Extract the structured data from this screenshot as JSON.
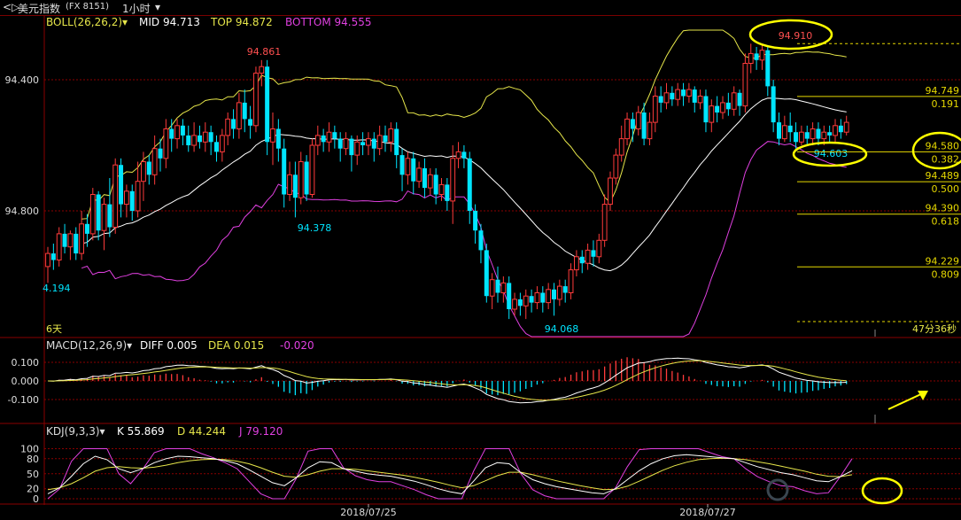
{
  "title": {
    "nav_icon": "back-forward-icon",
    "instrument": "美元指数",
    "code": "(FX 8151)",
    "period": "1小时"
  },
  "boll": {
    "label": "BOLL(26,26,2)",
    "mid": "MID 94.713",
    "top": "TOP 94.872",
    "bottom": "BOTTOM 94.555"
  },
  "macd": {
    "label": "MACD(12,26,9)",
    "diff": "DIFF 0.005",
    "dea": "DEA 0.015",
    "macd": "-0.020"
  },
  "kdj": {
    "label": "KDJ(9,3,3)",
    "k": "K 55.869",
    "d": "D 44.244",
    "j": "J 79.120"
  },
  "colors": {
    "up": "#ff3b3b",
    "down": "#00e5ff",
    "mid": "#ffffff",
    "upper": "#e6e64a",
    "lower": "#e040e0",
    "grid": "#8a0000",
    "fib": "#e6d800",
    "highlight": "#ffff00"
  },
  "chart_data": [
    {
      "type": "candlestick",
      "ylim": [
        94.0,
        95.0
      ],
      "yticks": [
        94.4,
        94.8
      ],
      "ytick_labels": [
        "94.800",
        "94.400"
      ],
      "xtick_labels": [
        "2018/07/25",
        "2018/07/27"
      ],
      "annotations": {
        "high_left": "94.861",
        "low_left": "94.378",
        "low_bottom": "94.068",
        "low_edge": "4.194",
        "high_right": "94.910",
        "low_right": "94.603",
        "days_label": "6天",
        "countdown": "47分36秒"
      },
      "fib_levels": [
        {
          "price": "94.749",
          "ratio": "0.191",
          "value": 94.749
        },
        {
          "price": "94.580",
          "ratio": "0.382",
          "value": 94.58
        },
        {
          "price": "94.489",
          "ratio": "0.500",
          "value": 94.489
        },
        {
          "price": "94.390",
          "ratio": "0.618",
          "value": 94.39
        },
        {
          "price": "94.229",
          "ratio": "0.809",
          "value": 94.229
        }
      ],
      "fib_top": 94.91,
      "candles": [
        [
          94.23,
          94.27,
          94.18,
          94.29
        ],
        [
          94.27,
          94.25,
          94.22,
          94.3
        ],
        [
          94.25,
          94.33,
          94.23,
          94.35
        ],
        [
          94.33,
          94.29,
          94.27,
          94.36
        ],
        [
          94.29,
          94.33,
          94.25,
          94.34
        ],
        [
          94.33,
          94.27,
          94.25,
          94.35
        ],
        [
          94.27,
          94.36,
          94.25,
          94.4
        ],
        [
          94.36,
          94.33,
          94.29,
          94.39
        ],
        [
          94.33,
          94.45,
          94.31,
          94.47
        ],
        [
          94.45,
          94.34,
          94.31,
          94.46
        ],
        [
          94.34,
          94.42,
          94.28,
          94.44
        ],
        [
          94.42,
          94.35,
          94.32,
          94.5
        ],
        [
          94.35,
          94.54,
          94.33,
          94.56
        ],
        [
          94.54,
          94.42,
          94.38,
          94.56
        ],
        [
          94.42,
          94.46,
          94.38,
          94.48
        ],
        [
          94.46,
          94.4,
          94.37,
          94.48
        ],
        [
          94.4,
          94.49,
          94.38,
          94.55
        ],
        [
          94.49,
          94.55,
          94.43,
          94.58
        ],
        [
          94.55,
          94.51,
          94.48,
          94.57
        ],
        [
          94.51,
          94.59,
          94.48,
          94.63
        ],
        [
          94.59,
          94.56,
          94.52,
          94.62
        ],
        [
          94.56,
          94.65,
          94.53,
          94.68
        ],
        [
          94.65,
          94.62,
          94.58,
          94.68
        ],
        [
          94.62,
          94.66,
          94.59,
          94.68
        ],
        [
          94.66,
          94.63,
          94.6,
          94.68
        ],
        [
          94.63,
          94.6,
          94.58,
          94.66
        ],
        [
          94.6,
          94.63,
          94.58,
          94.67
        ],
        [
          94.63,
          94.61,
          94.59,
          94.66
        ],
        [
          94.61,
          94.64,
          94.58,
          94.67
        ],
        [
          94.64,
          94.61,
          94.57,
          94.66
        ],
        [
          94.61,
          94.58,
          94.55,
          94.63
        ],
        [
          94.58,
          94.63,
          94.55,
          94.65
        ],
        [
          94.63,
          94.68,
          94.6,
          94.7
        ],
        [
          94.68,
          94.65,
          94.62,
          94.71
        ],
        [
          94.65,
          94.73,
          94.62,
          94.76
        ],
        [
          94.73,
          94.68,
          94.64,
          94.77
        ],
        [
          94.68,
          94.66,
          94.62,
          94.72
        ],
        [
          94.66,
          94.82,
          94.64,
          94.84
        ],
        [
          94.82,
          94.84,
          94.78,
          94.86
        ],
        [
          94.84,
          94.61,
          94.57,
          94.86
        ],
        [
          94.61,
          94.65,
          94.54,
          94.7
        ],
        [
          94.65,
          94.59,
          94.55,
          94.68
        ],
        [
          94.59,
          94.45,
          94.41,
          94.62
        ],
        [
          94.45,
          94.51,
          94.43,
          94.55
        ],
        [
          94.51,
          94.44,
          94.38,
          94.55
        ],
        [
          94.44,
          94.55,
          94.42,
          94.58
        ],
        [
          94.55,
          94.45,
          94.43,
          94.57
        ],
        [
          94.45,
          94.6,
          94.44,
          94.62
        ],
        [
          94.6,
          94.63,
          94.57,
          94.66
        ],
        [
          94.63,
          94.61,
          94.58,
          94.65
        ],
        [
          94.61,
          94.64,
          94.58,
          94.67
        ],
        [
          94.64,
          94.62,
          94.59,
          94.66
        ],
        [
          94.62,
          94.59,
          94.55,
          94.64
        ],
        [
          94.59,
          94.62,
          94.57,
          94.64
        ],
        [
          94.62,
          94.57,
          94.52,
          94.63
        ],
        [
          94.57,
          94.61,
          94.54,
          94.63
        ],
        [
          94.61,
          94.6,
          94.57,
          94.64
        ],
        [
          94.6,
          94.62,
          94.57,
          94.64
        ],
        [
          94.62,
          94.59,
          94.55,
          94.64
        ],
        [
          94.59,
          94.63,
          94.57,
          94.66
        ],
        [
          94.63,
          94.61,
          94.58,
          94.66
        ],
        [
          94.61,
          94.65,
          94.58,
          94.67
        ],
        [
          94.65,
          94.57,
          94.53,
          94.67
        ],
        [
          94.57,
          94.51,
          94.46,
          94.59
        ],
        [
          94.51,
          94.56,
          94.48,
          94.58
        ],
        [
          94.56,
          94.49,
          94.45,
          94.58
        ],
        [
          94.49,
          94.53,
          94.47,
          94.55
        ],
        [
          94.53,
          94.47,
          94.44,
          94.56
        ],
        [
          94.47,
          94.51,
          94.45,
          94.53
        ],
        [
          94.51,
          94.45,
          94.42,
          94.53
        ],
        [
          94.45,
          94.48,
          94.43,
          94.5
        ],
        [
          94.48,
          94.43,
          94.4,
          94.5
        ],
        [
          94.43,
          94.56,
          94.36,
          94.6
        ],
        [
          94.56,
          94.58,
          94.53,
          94.61
        ],
        [
          94.58,
          94.56,
          94.53,
          94.6
        ],
        [
          94.56,
          94.4,
          94.36,
          94.58
        ],
        [
          94.4,
          94.34,
          94.3,
          94.42
        ],
        [
          94.34,
          94.28,
          94.24,
          94.36
        ],
        [
          94.28,
          94.14,
          94.12,
          94.3
        ],
        [
          94.14,
          94.19,
          94.1,
          94.21
        ],
        [
          94.19,
          94.15,
          94.12,
          94.23
        ],
        [
          94.15,
          94.18,
          94.12,
          94.2
        ],
        [
          94.18,
          94.1,
          94.07,
          94.2
        ],
        [
          94.1,
          94.13,
          94.08,
          94.15
        ],
        [
          94.13,
          94.11,
          94.08,
          94.15
        ],
        [
          94.11,
          94.14,
          94.07,
          94.16
        ],
        [
          94.14,
          94.12,
          94.09,
          94.16
        ],
        [
          94.12,
          94.15,
          94.1,
          94.17
        ],
        [
          94.15,
          94.12,
          94.09,
          94.17
        ],
        [
          94.12,
          94.16,
          94.1,
          94.18
        ],
        [
          94.16,
          94.13,
          94.08,
          94.18
        ],
        [
          94.13,
          94.17,
          94.11,
          94.19
        ],
        [
          94.17,
          94.15,
          94.12,
          94.19
        ],
        [
          94.15,
          94.22,
          94.13,
          94.24
        ],
        [
          94.22,
          94.26,
          94.2,
          94.28
        ],
        [
          94.26,
          94.24,
          94.21,
          94.28
        ],
        [
          94.24,
          94.28,
          94.22,
          94.3
        ],
        [
          94.28,
          94.26,
          94.23,
          94.31
        ],
        [
          94.26,
          94.31,
          94.24,
          94.33
        ],
        [
          94.31,
          94.42,
          94.29,
          94.45
        ],
        [
          94.42,
          94.5,
          94.4,
          94.52
        ],
        [
          94.5,
          94.57,
          94.48,
          94.59
        ],
        [
          94.57,
          94.62,
          94.55,
          94.66
        ],
        [
          94.62,
          94.68,
          94.6,
          94.7
        ],
        [
          94.68,
          94.65,
          94.61,
          94.7
        ],
        [
          94.65,
          94.7,
          94.63,
          94.72
        ],
        [
          94.7,
          94.62,
          94.6,
          94.73
        ],
        [
          94.62,
          94.67,
          94.6,
          94.7
        ],
        [
          94.67,
          94.75,
          94.64,
          94.78
        ],
        [
          94.75,
          94.73,
          94.7,
          94.78
        ],
        [
          94.73,
          94.76,
          94.71,
          94.79
        ],
        [
          94.76,
          94.74,
          94.72,
          94.78
        ],
        [
          94.74,
          94.77,
          94.72,
          94.79
        ],
        [
          94.77,
          94.75,
          94.72,
          94.79
        ],
        [
          94.75,
          94.77,
          94.73,
          94.79
        ],
        [
          94.77,
          94.73,
          94.7,
          94.78
        ],
        [
          94.73,
          94.75,
          94.71,
          94.77
        ],
        [
          94.75,
          94.67,
          94.64,
          94.77
        ],
        [
          94.67,
          94.72,
          94.64,
          94.74
        ],
        [
          94.72,
          94.7,
          94.67,
          94.75
        ],
        [
          94.7,
          94.73,
          94.68,
          94.75
        ],
        [
          94.73,
          94.71,
          94.69,
          94.76
        ],
        [
          94.71,
          94.76,
          94.69,
          94.78
        ],
        [
          94.76,
          94.72,
          94.69,
          94.77
        ],
        [
          94.72,
          94.85,
          94.7,
          94.88
        ],
        [
          94.85,
          94.88,
          94.82,
          94.91
        ],
        [
          94.88,
          94.86,
          94.83,
          94.9
        ],
        [
          94.86,
          94.89,
          94.83,
          94.91
        ],
        [
          94.89,
          94.78,
          94.75,
          94.9
        ],
        [
          94.78,
          94.67,
          94.64,
          94.8
        ],
        [
          94.67,
          94.62,
          94.6,
          94.7
        ],
        [
          94.62,
          94.66,
          94.61,
          94.69
        ],
        [
          94.66,
          94.64,
          94.61,
          94.7
        ],
        [
          94.64,
          94.61,
          94.59,
          94.67
        ],
        [
          94.61,
          94.64,
          94.6,
          94.66
        ],
        [
          94.64,
          94.62,
          94.6,
          94.66
        ],
        [
          94.62,
          94.65,
          94.6,
          94.67
        ],
        [
          94.65,
          94.62,
          94.6,
          94.67
        ],
        [
          94.62,
          94.64,
          94.6,
          94.66
        ],
        [
          94.64,
          94.63,
          94.61,
          94.66
        ],
        [
          94.63,
          94.66,
          94.61,
          94.68
        ],
        [
          94.66,
          94.64,
          94.62,
          94.68
        ],
        [
          94.64,
          94.67,
          94.63,
          94.69
        ]
      ]
    },
    {
      "type": "bar",
      "name": "MACD",
      "ylim": [
        -0.2,
        0.18
      ],
      "yticks": [
        0.1,
        0.0,
        -0.1
      ],
      "ytick_labels": [
        "0.100",
        "0.000",
        "-0.100"
      ]
    },
    {
      "type": "line",
      "name": "KDJ",
      "ylim": [
        0,
        110
      ],
      "yticks": [
        100,
        80,
        50,
        20,
        0
      ],
      "ytick_labels": [
        "100",
        "80",
        "50",
        "20",
        "0"
      ],
      "k": [
        10,
        22,
        45,
        70,
        85,
        78,
        60,
        52,
        60,
        72,
        80,
        85,
        84,
        82,
        80,
        76,
        70,
        58,
        45,
        32,
        26,
        42,
        62,
        74,
        72,
        60,
        55,
        50,
        47,
        45,
        40,
        35,
        28,
        20,
        14,
        10,
        35,
        62,
        72,
        70,
        52,
        38,
        30,
        24,
        20,
        16,
        12,
        10,
        20,
        38,
        56,
        70,
        80,
        86,
        88,
        86,
        84,
        82,
        80,
        72,
        64,
        58,
        52,
        48,
        42,
        36,
        34,
        44,
        56
      ],
      "d": [
        18,
        22,
        30,
        42,
        55,
        62,
        64,
        62,
        61,
        63,
        67,
        72,
        76,
        78,
        79,
        78,
        75,
        70,
        62,
        53,
        45,
        43,
        48,
        55,
        60,
        60,
        59,
        56,
        53,
        50,
        47,
        43,
        38,
        33,
        27,
        22,
        26,
        36,
        46,
        53,
        53,
        48,
        42,
        36,
        31,
        26,
        22,
        18,
        19,
        25,
        35,
        46,
        57,
        66,
        73,
        78,
        80,
        81,
        80,
        78,
        74,
        70,
        65,
        60,
        55,
        49,
        45,
        44,
        48
      ],
      "j": [
        0,
        20,
        75,
        100,
        100,
        100,
        50,
        30,
        58,
        92,
        100,
        100,
        100,
        90,
        82,
        72,
        60,
        35,
        10,
        0,
        0,
        40,
        95,
        100,
        100,
        62,
        46,
        38,
        34,
        34,
        26,
        18,
        8,
        0,
        0,
        0,
        55,
        100,
        100,
        100,
        50,
        18,
        6,
        0,
        0,
        0,
        0,
        0,
        22,
        64,
        98,
        100,
        100,
        100,
        100,
        100,
        92,
        84,
        80,
        60,
        44,
        34,
        26,
        24,
        16,
        10,
        12,
        44,
        80
      ]
    }
  ]
}
